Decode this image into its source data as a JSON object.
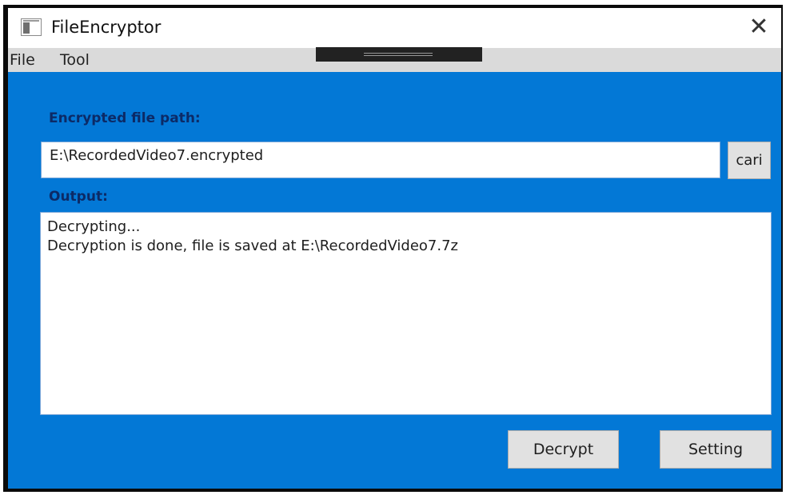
{
  "window": {
    "title": "FileEncryptor",
    "close_glyph": "✕",
    "icon": "app-window-icon"
  },
  "menu": {
    "items": [
      {
        "label": "File"
      },
      {
        "label": "Tool"
      }
    ]
  },
  "form": {
    "path_label": "Encrypted file path:",
    "path_value": "E:\\RecordedVideo7.encrypted",
    "browse_label": "cari",
    "output_label": "Output:",
    "output_lines": [
      "Decrypting...",
      "Decryption is done, file is saved at E:\\RecordedVideo7.7z"
    ]
  },
  "actions": {
    "decrypt_label": "Decrypt",
    "setting_label": "Setting"
  },
  "colors": {
    "client_background": "#0378d6",
    "label_text": "#0c2a66",
    "button_background": "#e1e1e1",
    "menubar_background": "#dadada"
  }
}
